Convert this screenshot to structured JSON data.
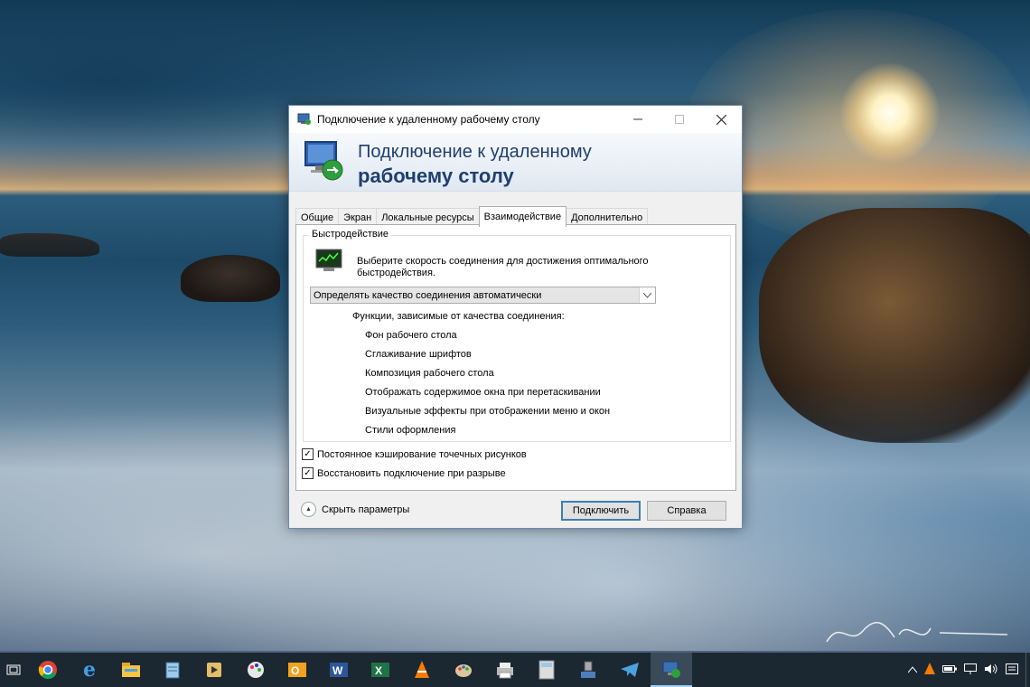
{
  "dialog": {
    "title": "Подключение к удаленному рабочему столу",
    "banner_line1": "Подключение к удаленному",
    "banner_line2": "рабочему столу",
    "tabs": [
      "Общие",
      "Экран",
      "Локальные ресурсы",
      "Взаимодействие",
      "Дополнительно"
    ],
    "active_tab": "Взаимодействие",
    "group_title": "Быстродействие",
    "perf_text": "Выберите скорость соединения для достижения оптимального быстродействия.",
    "connection_select": "Определять качество соединения автоматически",
    "features_title": "Функции, зависимые от качества соединения:",
    "features": [
      "Фон рабочего стола",
      "Сглаживание шрифтов",
      "Композиция рабочего стола",
      "Отображать содержимое окна при перетаскивании",
      "Визуальные эффекты при отображении меню и окон",
      "Стили оформления"
    ],
    "checkbox_bitmap": "Постоянное кэширование точечных рисунков",
    "checkbox_bitmap_checked": true,
    "checkbox_reconnect": "Восстановить подключение при разрыве",
    "checkbox_reconnect_checked": true,
    "hide_params": "Скрыть параметры",
    "connect_button": "Подключить",
    "help_button": "Справка"
  },
  "taskbar": {
    "items": [
      "task-view-icon",
      "chrome-icon",
      "internet-explorer-icon",
      "file-explorer-icon",
      "notepad-icon",
      "media-player-icon",
      "paint-icon",
      "outlook-icon",
      "word-icon",
      "excel-icon",
      "vlc-icon",
      "paint-brush-icon",
      "printer-icon",
      "calculator-icon",
      "network-icon",
      "telegram-icon",
      "remote-desktop-icon"
    ]
  }
}
